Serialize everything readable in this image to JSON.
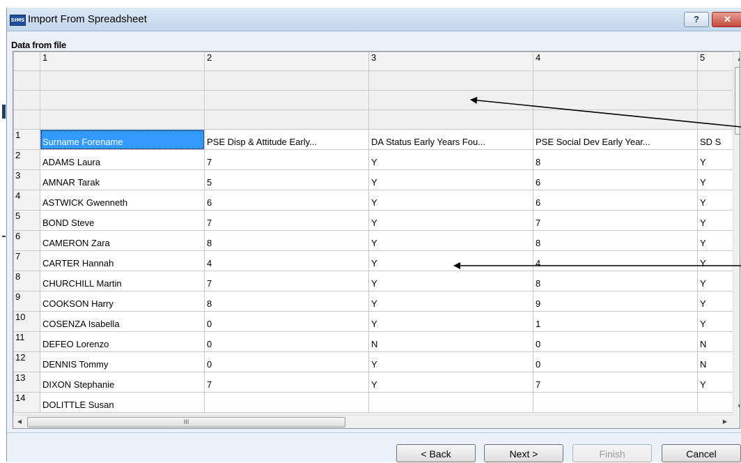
{
  "window": {
    "title": "Import From Spreadsheet",
    "app_badge": "SIMS",
    "help_label": "?",
    "close_label": "✕"
  },
  "section_label": "Data from file",
  "grid": {
    "column_headers": [
      "1",
      "2",
      "3",
      "4",
      "5"
    ],
    "rows": [
      {
        "num": "1",
        "cells": [
          "Surname Forename",
          "PSE Disp & Attitude Early...",
          "DA Status Early Years Fou...",
          "PSE Social Dev Early Year...",
          "SD S"
        ]
      },
      {
        "num": "2",
        "cells": [
          "ADAMS Laura",
          "7",
          "Y",
          "8",
          "Y"
        ]
      },
      {
        "num": "3",
        "cells": [
          "AMNAR Tarak",
          "5",
          "Y",
          "6",
          "Y"
        ]
      },
      {
        "num": "4",
        "cells": [
          "ASTWICK Gwenneth",
          "6",
          "Y",
          "6",
          "Y"
        ]
      },
      {
        "num": "5",
        "cells": [
          "BOND Steve",
          "7",
          "Y",
          "7",
          "Y"
        ]
      },
      {
        "num": "6",
        "cells": [
          "CAMERON Zara",
          "8",
          "Y",
          "8",
          "Y"
        ]
      },
      {
        "num": "7",
        "cells": [
          "CARTER Hannah",
          "4",
          "Y",
          "4",
          "Y"
        ]
      },
      {
        "num": "8",
        "cells": [
          "CHURCHILL Martin",
          "7",
          "Y",
          "8",
          "Y"
        ]
      },
      {
        "num": "9",
        "cells": [
          "COOKSON Harry",
          "8",
          "Y",
          "9",
          "Y"
        ]
      },
      {
        "num": "10",
        "cells": [
          "COSENZA Isabella",
          "0",
          "Y",
          "1",
          "Y"
        ]
      },
      {
        "num": "11",
        "cells": [
          "DEFEO Lorenzo",
          "0",
          "N",
          "0",
          "N"
        ]
      },
      {
        "num": "12",
        "cells": [
          "DENNIS Tommy",
          "0",
          "Y",
          "0",
          "N"
        ]
      },
      {
        "num": "13",
        "cells": [
          "DIXON Stephanie",
          "7",
          "Y",
          "7",
          "Y"
        ]
      },
      {
        "num": "14",
        "cells": [
          "DOLITTLE Susan",
          "",
          "",
          "",
          ""
        ]
      }
    ],
    "hscroll_grip": "III"
  },
  "buttons": {
    "back": "< Back",
    "next": "Next >",
    "finish": "Finish",
    "cancel": "Cancel"
  }
}
